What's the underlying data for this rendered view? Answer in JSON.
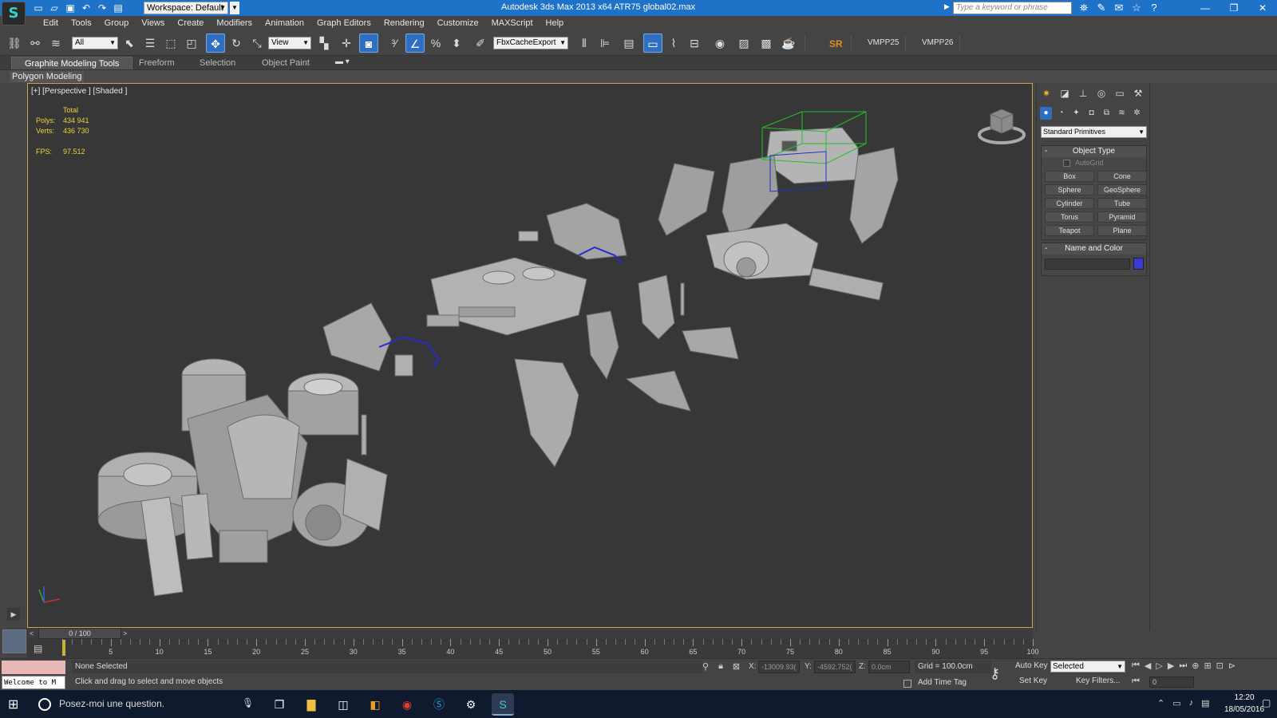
{
  "titlebar": {
    "app_logo": "S",
    "workspace": "Workspace: Default",
    "title": "Autodesk 3ds Max  2013 x64      ATR75 global02.max",
    "search_placeholder": "Type a keyword or phrase"
  },
  "menu": [
    "Edit",
    "Tools",
    "Group",
    "Views",
    "Create",
    "Modifiers",
    "Animation",
    "Graph Editors",
    "Rendering",
    "Customize",
    "MAXScript",
    "Help"
  ],
  "toolbar": {
    "filter_value": "All",
    "refcoord_value": "View",
    "selection_set_value": "FbxCacheExport",
    "sr_label": "SR",
    "vmpp25": "VMPP25",
    "vmpp26": "VMPP26"
  },
  "ribbon": {
    "tabs": [
      "Graphite Modeling Tools",
      "Freeform",
      "Selection",
      "Object Paint"
    ],
    "active_tab": 0,
    "panel_label": "Polygon Modeling"
  },
  "viewport": {
    "label": "[+] [Perspective ] [Shaded ]",
    "stats_header": "Total",
    "polys_label": "Polys:",
    "polys_value": "434 941",
    "verts_label": "Verts:",
    "verts_value": "436 730",
    "fps_label": "FPS:",
    "fps_value": "97.512"
  },
  "command_panel": {
    "category": "Standard Primitives",
    "object_type_title": "Object Type",
    "autogrid_label": "AutoGrid",
    "primitives": [
      "Box",
      "Cone",
      "Sphere",
      "GeoSphere",
      "Cylinder",
      "Tube",
      "Torus",
      "Pyramid",
      "Teapot",
      "Plane"
    ],
    "name_color_title": "Name and Color",
    "object_color": "#3a3ad8"
  },
  "timeline": {
    "frame_display": "0 / 100",
    "ticks": [
      "5",
      "10",
      "15",
      "20",
      "25",
      "30",
      "35",
      "40",
      "45",
      "50",
      "55",
      "60",
      "65",
      "70",
      "75",
      "80",
      "85",
      "90",
      "95",
      "100"
    ]
  },
  "status": {
    "listener_text": "Welcome to M",
    "selection_info": "None Selected",
    "prompt": "Click and drag to select and move objects",
    "x_label": "X:",
    "x_value": "-13009.93(",
    "y_label": "Y:",
    "y_value": "-4592.752(",
    "z_label": "Z:",
    "z_value": "0.0cm",
    "grid": "Grid = 100.0cm",
    "add_time_tag": "Add Time Tag",
    "auto_key": "Auto Key",
    "set_key": "Set Key",
    "key_mode": "Selected",
    "key_filters": "Key Filters...",
    "current_frame": "0"
  },
  "taskbar": {
    "search_text": "Posez-moi une question.",
    "time": "12:20",
    "date": "18/05/2016"
  }
}
